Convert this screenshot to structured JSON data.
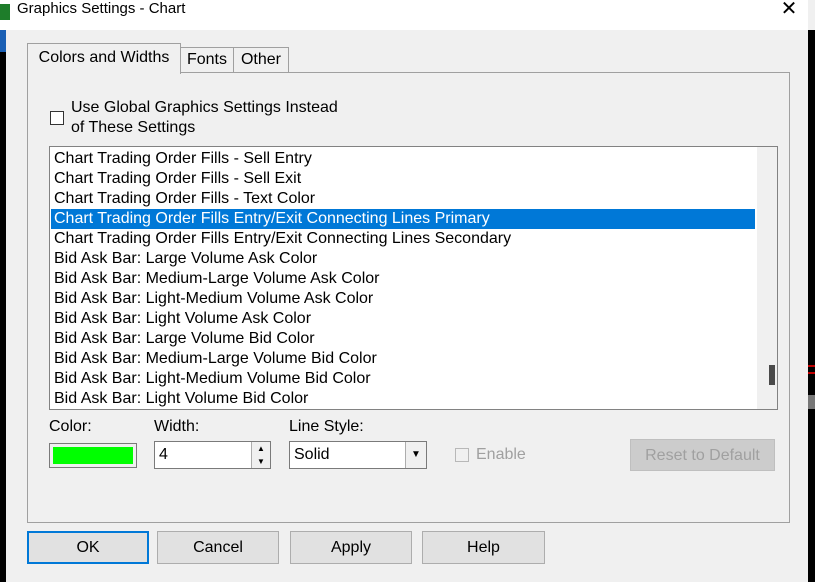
{
  "window": {
    "title": "Graphics Settings  - Chart",
    "close_icon": "close-icon"
  },
  "tabs": [
    {
      "label": "Colors and Widths",
      "active": true
    },
    {
      "label": "Fonts",
      "active": false
    },
    {
      "label": "Other",
      "active": false
    }
  ],
  "global_checkbox": {
    "label_line1": "Use Global Graphics Settings Instead",
    "label_line2": "of These Settings",
    "checked": false
  },
  "list": {
    "items": [
      "Chart Trading Order Fills - Sell Entry",
      "Chart Trading Order Fills - Sell Exit",
      "Chart Trading Order Fills - Text Color",
      "Chart Trading Order Fills Entry/Exit Connecting Lines Primary",
      "Chart Trading Order Fills Entry/Exit Connecting Lines Secondary",
      "Bid Ask Bar: Large Volume Ask Color",
      "Bid Ask Bar: Medium-Large Volume Ask Color",
      "Bid Ask Bar: Light-Medium Volume Ask Color",
      "Bid Ask Bar: Light Volume Ask Color",
      "Bid Ask Bar: Large Volume Bid Color",
      "Bid Ask Bar: Medium-Large Volume Bid Color",
      "Bid Ask Bar: Light-Medium Volume Bid Color",
      "Bid Ask Bar: Light Volume Bid Color"
    ],
    "selected_index": 3
  },
  "controls": {
    "color_label": "Color:",
    "color_value": "#00ff00",
    "width_label": "Width:",
    "width_value": "4",
    "line_style_label": "Line Style:",
    "line_style_value": "Solid",
    "enable_label": "Enable",
    "enable_checked": false,
    "reset_label": "Reset to Default"
  },
  "buttons": {
    "ok": "OK",
    "cancel": "Cancel",
    "apply": "Apply",
    "help": "Help"
  },
  "colors": {
    "selection": "#0078d7",
    "swatch": "#00ff00"
  }
}
